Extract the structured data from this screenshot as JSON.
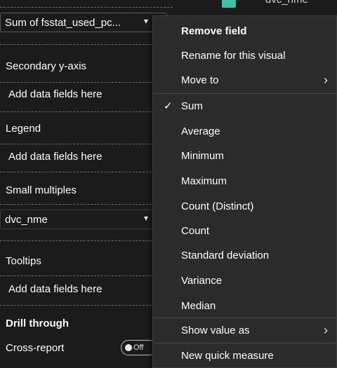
{
  "header_strip": {
    "text": "dvc_nme"
  },
  "wells": {
    "value_field": "Sum of fsstat_used_pc...",
    "secondary_y_axis_label": "Secondary y-axis",
    "secondary_y_axis_placeholder": "Add data fields here",
    "legend_label": "Legend",
    "legend_placeholder": "Add data fields here",
    "small_multiples_label": "Small multiples",
    "small_multiples_field": "dvc_nme",
    "tooltips_label": "Tooltips",
    "tooltips_placeholder": "Add data fields here",
    "drill_through_label": "Drill through",
    "cross_report_label": "Cross-report",
    "cross_report_toggle": "Off"
  },
  "menu": {
    "remove_field": "Remove field",
    "rename": "Rename for this visual",
    "move_to": "Move to",
    "aggregations": [
      "Sum",
      "Average",
      "Minimum",
      "Maximum",
      "Count (Distinct)",
      "Count",
      "Standard deviation",
      "Variance",
      "Median"
    ],
    "selected_aggregation": "Sum",
    "show_value_as": "Show value as",
    "new_quick_measure": "New quick measure"
  },
  "colors": {
    "background": "#1b1b1b",
    "menu_background": "#2b2b2b",
    "legend_swatch": "#3fbfa6"
  }
}
